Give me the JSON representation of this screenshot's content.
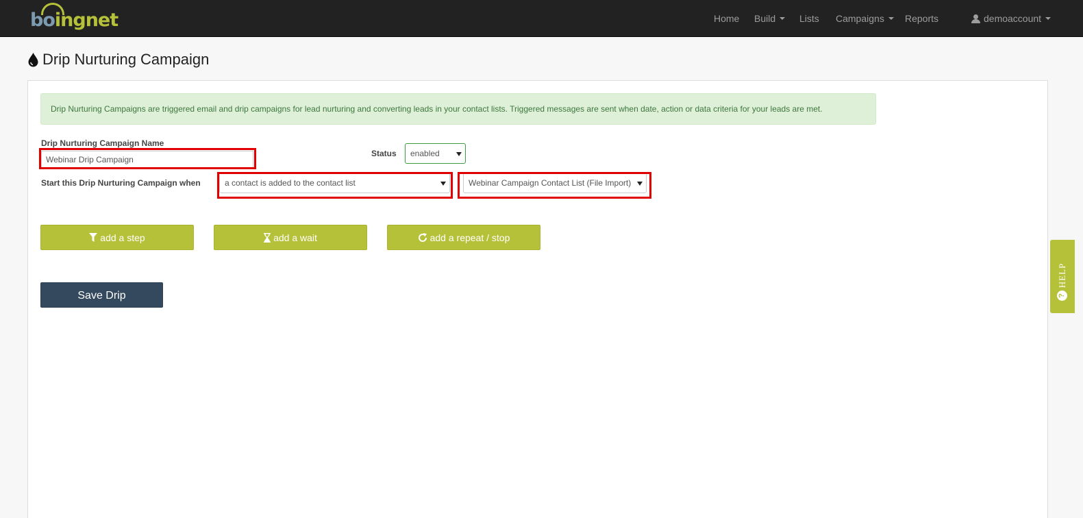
{
  "brand": {
    "logo_prefix": "bo",
    "logo_mid": "i",
    "logo_suffix": "ngnet",
    "accent": "#b6c13a",
    "dark": "#222222",
    "save_color": "#34495e",
    "highlight": "#e00000"
  },
  "nav": {
    "home": "Home",
    "build": "Build",
    "lists": "Lists",
    "campaigns": "Campaigns",
    "reports": "Reports",
    "user": "demoaccount"
  },
  "page": {
    "title": "Drip Nurturing Campaign",
    "icon": "drop-icon"
  },
  "alert": {
    "text": "Drip Nurturing Campaigns are triggered email and drip campaigns for lead nurturing and converting leads in your contact lists. Triggered messages are sent when date, action or data criteria for your leads are met."
  },
  "form": {
    "name_label": "Drip Nurturing Campaign Name",
    "name_value": "Webinar Drip Campaign",
    "status_label": "Status",
    "status_value": "enabled",
    "start_label": "Start this Drip Nurturing Campaign when",
    "trigger_value": "a contact is added to the contact list",
    "list_value": "Webinar Campaign Contact List (File Import)"
  },
  "buttons": {
    "add_step": "add a step",
    "add_wait": "add a wait",
    "add_repeat": "add a repeat / stop",
    "save": "Save Drip"
  },
  "help": {
    "label": "HELP",
    "icon_glyph": "?"
  }
}
